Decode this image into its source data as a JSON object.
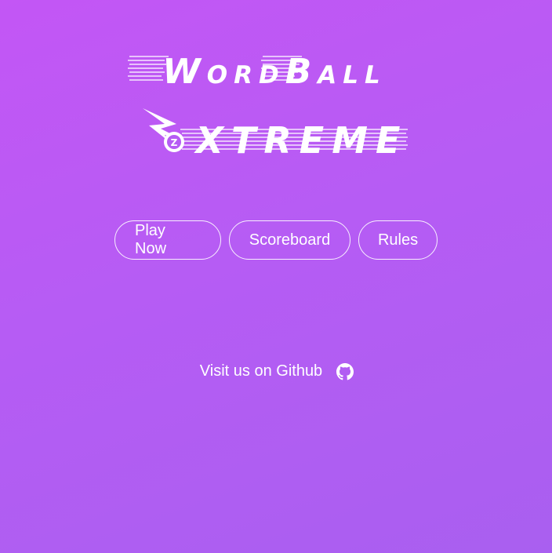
{
  "logo": {
    "line1": "WordBall",
    "line2": "Xtreme"
  },
  "nav": {
    "play_label": "Play Now",
    "scoreboard_label": "Scoreboard",
    "rules_label": "Rules"
  },
  "footer": {
    "github_text": "Visit us on Github",
    "github_icon": "github-icon"
  },
  "colors": {
    "background_start": "#c356f5",
    "background_end": "#a95ff0",
    "text": "#ffffff"
  }
}
